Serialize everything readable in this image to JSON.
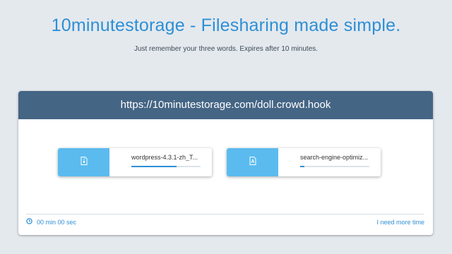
{
  "header": {
    "title": "10minutestorage - Filesharing made simple.",
    "subtitle": "Just remember your three words. Expires after 10 minutes."
  },
  "card": {
    "url": "https://10minutestorage.com/doll.crowd.hook",
    "files": [
      {
        "name": "wordpress-4.3.1-zh_T...",
        "icon": "zip-file-icon",
        "progress": 0.65
      },
      {
        "name": "search-engine-optimiz...",
        "icon": "pdf-file-icon",
        "progress": 0.06
      }
    ],
    "timer": "00 min 00 sec",
    "more_time_link": "I need more time"
  },
  "colors": {
    "accent": "#2d8fd5",
    "header_bg": "#456585",
    "file_icon_bg": "#5bbbef",
    "page_bg": "#e4e9ee"
  }
}
